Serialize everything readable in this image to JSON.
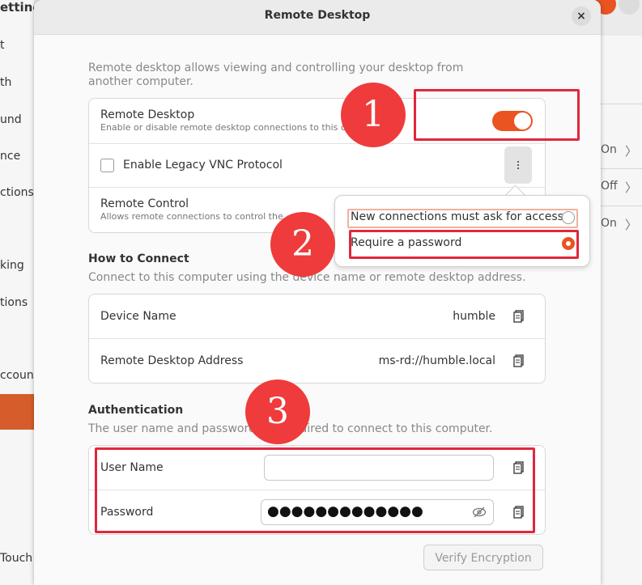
{
  "background_window": {
    "title_fragment": "etting",
    "left_items": [
      "t",
      "th",
      "und",
      "nce",
      "ctions",
      "king",
      "tions",
      "ccount",
      "Touch"
    ],
    "right_values": [
      "On",
      "Off",
      "On"
    ]
  },
  "dialog": {
    "title": "Remote Desktop",
    "close_glyph": "×",
    "intro": "Remote desktop allows viewing and controlling your desktop from another computer.",
    "remote_desktop": {
      "title": "Remote Desktop",
      "subtitle": "Enable or disable remote desktop connections to this computer.",
      "enabled": true
    },
    "legacy_vnc": {
      "label": "Enable Legacy VNC Protocol",
      "checked": false
    },
    "remote_control": {
      "title": "Remote Control",
      "subtitle": "Allows remote connections to control the screen."
    },
    "popover": {
      "options": [
        {
          "label": "New connections must ask for access",
          "selected": false
        },
        {
          "label": "Require a password",
          "selected": true
        }
      ]
    },
    "how_to_connect": {
      "heading": "How to Connect",
      "description": "Connect to this computer using the device name or remote desktop address.",
      "device_name_label": "Device Name",
      "device_name_value": "humble",
      "address_label": "Remote Desktop Address",
      "address_value": "ms-rd://humble.local"
    },
    "authentication": {
      "heading": "Authentication",
      "description": "The user name and password are required to connect to this computer.",
      "user_name_label": "User Name",
      "user_name_value": "",
      "password_label": "Password",
      "password_masked": "●●●●●●●●●●●●●"
    },
    "verify_button": "Verify Encryption"
  },
  "annotations": {
    "badges": [
      "1",
      "2",
      "3"
    ],
    "color": "#e0283c"
  },
  "colors": {
    "accent": "#e95420"
  }
}
